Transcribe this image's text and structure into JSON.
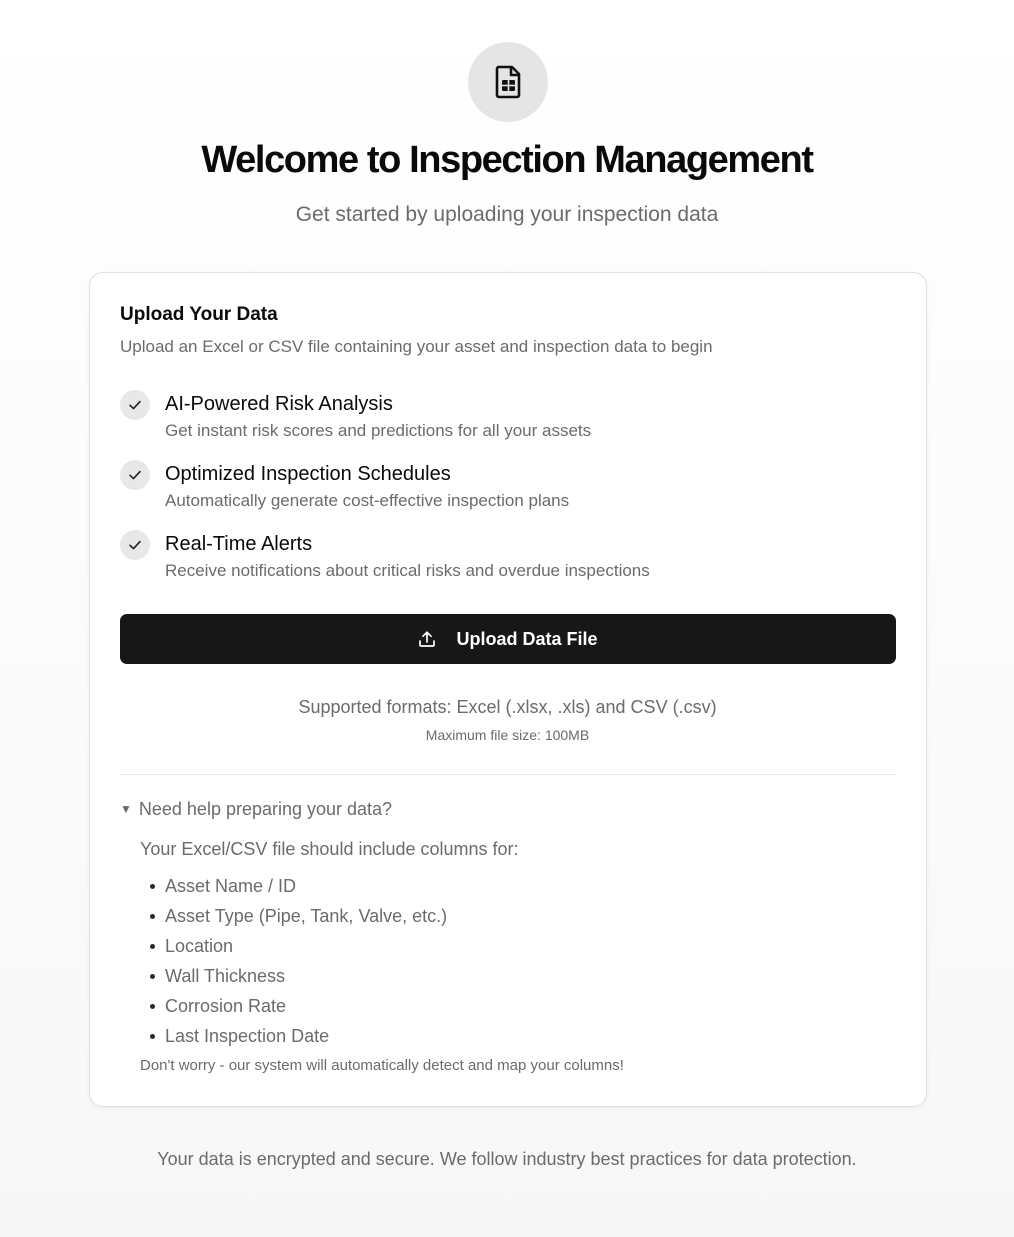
{
  "hero": {
    "icon": "spreadsheet-file-icon",
    "title": "Welcome to Inspection Management",
    "subtitle": "Get started by uploading your inspection data"
  },
  "card": {
    "title": "Upload Your Data",
    "description": "Upload an Excel or CSV file containing your asset and inspection data to begin",
    "features": [
      {
        "icon": "check-icon",
        "title": "AI-Powered Risk Analysis",
        "description": "Get instant risk scores and predictions for all your assets"
      },
      {
        "icon": "check-icon",
        "title": "Optimized Inspection Schedules",
        "description": "Automatically generate cost-effective inspection plans"
      },
      {
        "icon": "check-icon",
        "title": "Real-Time Alerts",
        "description": "Receive notifications about critical risks and overdue inspections"
      }
    ],
    "upload_button": {
      "icon": "upload-icon",
      "label": "Upload Data File"
    },
    "supported_formats": "Supported formats: Excel (.xlsx, .xls) and CSV (.csv)",
    "max_size": "Maximum file size: 100MB",
    "help": {
      "toggle_icon": "triangle-down-icon",
      "toggle_label": "Need help preparing your data?",
      "intro": "Your Excel/CSV file should include columns for:",
      "columns": [
        "Asset Name / ID",
        "Asset Type (Pipe, Tank, Valve, etc.)",
        "Location",
        "Wall Thickness",
        "Corrosion Rate",
        "Last Inspection Date"
      ],
      "note": "Don't worry - our system will automatically detect and map your columns!"
    }
  },
  "footer": {
    "security_note": "Your data is encrypted and secure. We follow industry best practices for data protection."
  }
}
